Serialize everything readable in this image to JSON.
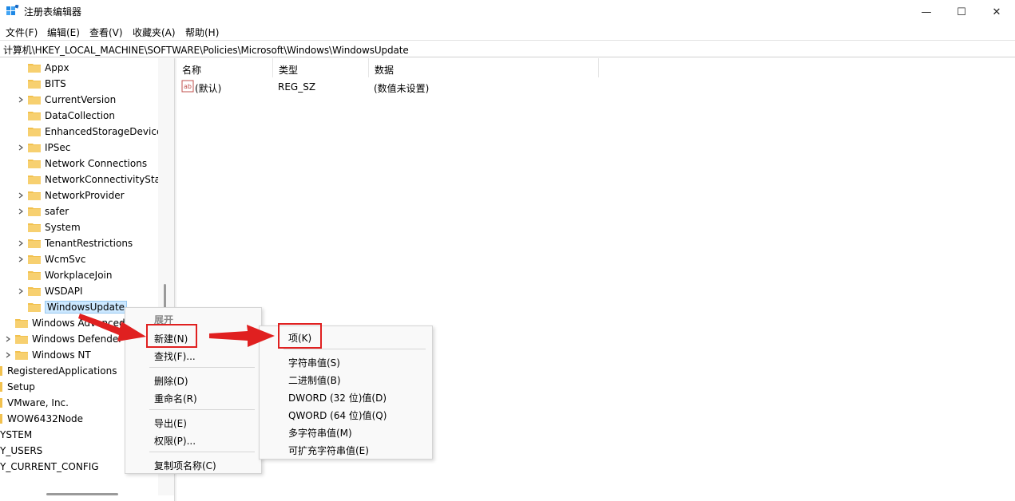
{
  "window": {
    "title": "注册表编辑器",
    "minimize_glyph": "—",
    "maximize_glyph": "☐",
    "close_glyph": "✕"
  },
  "menu": [
    "文件(F)",
    "编辑(E)",
    "查看(V)",
    "收藏夹(A)",
    "帮助(H)"
  ],
  "address": "计算机\\HKEY_LOCAL_MACHINE\\SOFTWARE\\Policies\\Microsoft\\Windows\\WindowsUpdate",
  "tree": {
    "items": [
      {
        "label": "Appx",
        "expandable": false
      },
      {
        "label": "BITS",
        "expandable": false
      },
      {
        "label": "CurrentVersion",
        "expandable": true
      },
      {
        "label": "DataCollection",
        "expandable": false
      },
      {
        "label": "EnhancedStorageDevices",
        "expandable": false
      },
      {
        "label": "IPSec",
        "expandable": true
      },
      {
        "label": "Network Connections",
        "expandable": false
      },
      {
        "label": "NetworkConnectivityStatusIndicator",
        "expandable": false
      },
      {
        "label": "NetworkProvider",
        "expandable": true
      },
      {
        "label": "safer",
        "expandable": true
      },
      {
        "label": "System",
        "expandable": false
      },
      {
        "label": "TenantRestrictions",
        "expandable": true
      },
      {
        "label": "WcmSvc",
        "expandable": true
      },
      {
        "label": "WorkplaceJoin",
        "expandable": false
      },
      {
        "label": "WSDAPI",
        "expandable": true
      },
      {
        "label": "WindowsUpdate",
        "expandable": false,
        "selected": true
      }
    ],
    "parent_items": [
      {
        "label": "Windows Advanced Threat Protection",
        "expandable": false
      },
      {
        "label": "Windows Defender",
        "expandable": true
      },
      {
        "label": "Windows NT",
        "expandable": true
      }
    ],
    "root_items": [
      {
        "label": "RegisteredApplications"
      },
      {
        "label": "Setup"
      },
      {
        "label": "VMware, Inc."
      },
      {
        "label": "WOW6432Node"
      }
    ],
    "hives": [
      "YSTEM",
      "Y_USERS",
      "Y_CURRENT_CONFIG"
    ]
  },
  "list": {
    "columns": [
      "名称",
      "类型",
      "数据"
    ],
    "rows": [
      {
        "name": "(默认)",
        "type": "REG_SZ",
        "data": "(数值未设置)",
        "icon": "string-value-icon"
      }
    ]
  },
  "context_menu": {
    "expand": "展开",
    "new": "新建(N)",
    "find": "查找(F)...",
    "delete": "删除(D)",
    "rename": "重命名(R)",
    "export": "导出(E)",
    "permissions": "权限(P)...",
    "copy_key_name": "复制项名称(C)"
  },
  "submenu": {
    "key": "项(K)",
    "string_value": "字符串值(S)",
    "binary_value": "二进制值(B)",
    "dword_value": "DWORD (32 位)值(D)",
    "qword_value": "QWORD (64 位)值(Q)",
    "multi_string_value": "多字符串值(M)",
    "expandable_string_value": "可扩充字符串值(E)"
  },
  "colors": {
    "folder": "#f2c14e",
    "highlight": "#e02020",
    "selection": "#cce8ff"
  }
}
